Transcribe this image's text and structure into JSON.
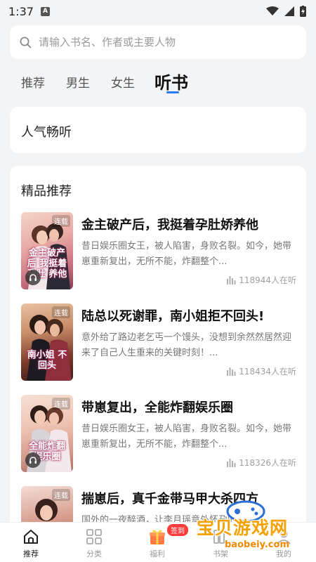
{
  "status_bar": {
    "time": "1:37",
    "notification_letter": "A"
  },
  "search": {
    "placeholder": "请输入书名、作者或主要人物"
  },
  "tabs": [
    {
      "label": "推荐"
    },
    {
      "label": "男生"
    },
    {
      "label": "女生"
    },
    {
      "label": "听书",
      "active": true
    }
  ],
  "popular_section": {
    "title": "人气畅听"
  },
  "featured_section": {
    "title": "精品推荐",
    "books": [
      {
        "title": "金主破产后，我挺着孕肚娇养他",
        "description": "昔日娱乐圈女王，被人陷害，身败名裂。如今，她带崽重新复出，无所不能，炸翻整个...",
        "listeners": "118944人在听",
        "cover_tag": "连载",
        "cover_text": "金主破产后 我挺着孕肚 养他"
      },
      {
        "title": "陆总以死谢罪，南小姐拒不回头!",
        "description": "意外给了路边老乞丐一个馒头，没想到余然然居然迎来了自己人生重来的关键时刻！...",
        "listeners": "118434人在听",
        "cover_tag": "连载",
        "cover_text": "南小姐 不回头"
      },
      {
        "title": "带崽复出，全能炸翻娱乐圈",
        "description": "昔日娱乐圈女王，被人陷害，身败名裂。如今，她带崽重新复出，无所不能，炸翻整个...",
        "listeners": "118326人在听",
        "cover_tag": "连载",
        "cover_text": "全能炸翻 娱乐圈"
      },
      {
        "title": "揣崽后，真千金带马甲大杀四方",
        "description": "国外的一夜醉酒，让李月瑶意外怀孕的...",
        "listeners": "",
        "cover_tag": "连载",
        "cover_text": ""
      }
    ]
  },
  "bottom_nav": [
    {
      "label": "推荐",
      "icon": "home-icon",
      "active": true
    },
    {
      "label": "分类",
      "icon": "grid-icon"
    },
    {
      "label": "福利",
      "icon": "gift-icon",
      "badge": "签到"
    },
    {
      "label": "书架",
      "icon": "bookshelf-icon"
    },
    {
      "label": "我的",
      "icon": "profile-icon"
    }
  ],
  "watermark": {
    "text": "宝贝游戏网",
    "url": "baobeiy.com"
  },
  "colors": {
    "accent": "#2b7bf0",
    "background": "#f3f4f6",
    "badge": "#ff3b3b"
  }
}
